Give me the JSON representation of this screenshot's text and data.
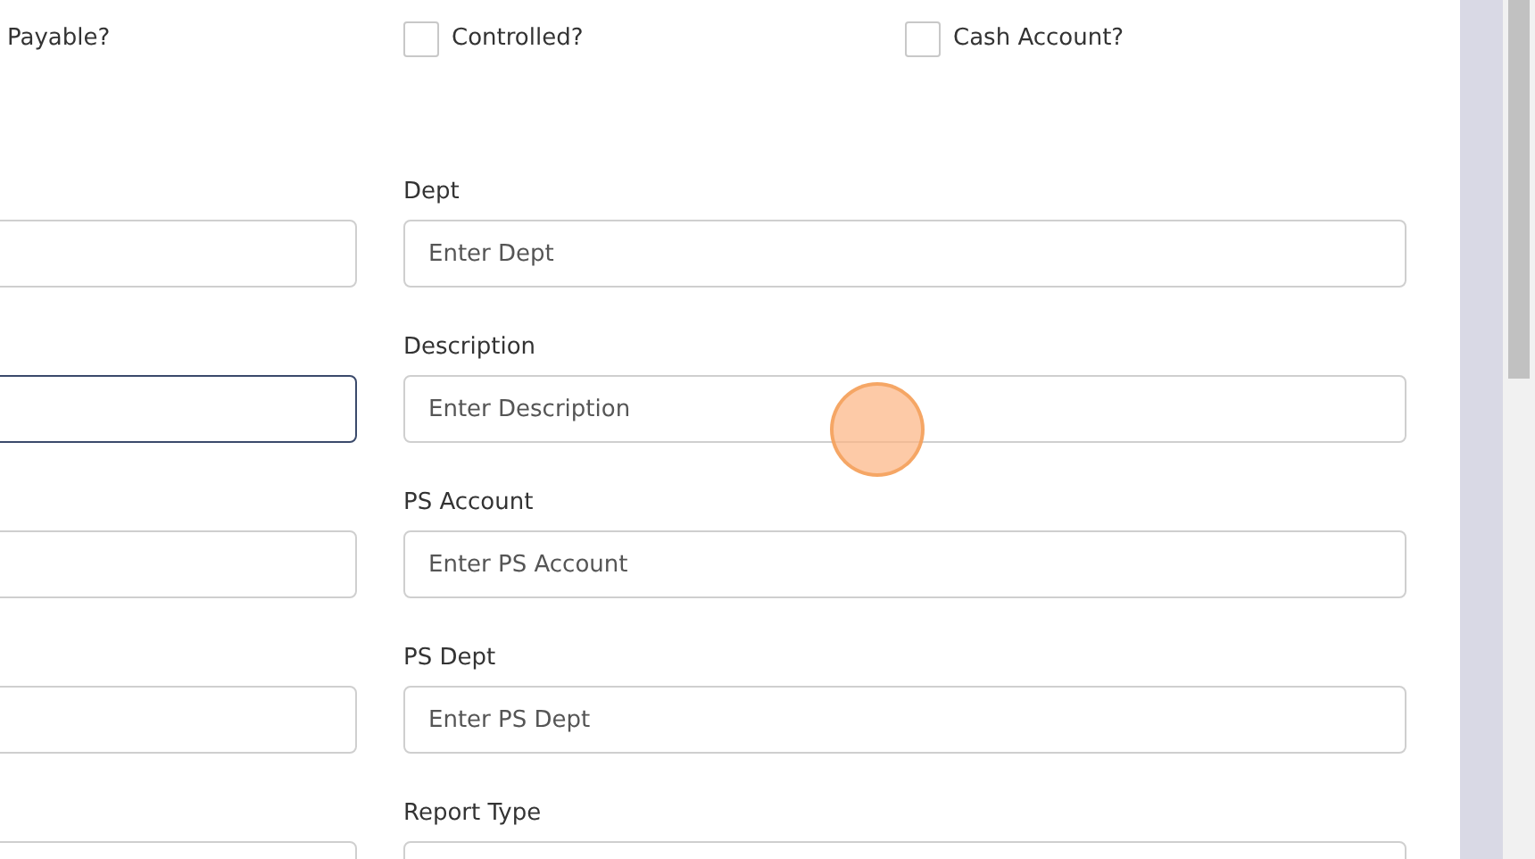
{
  "checkboxes": [
    {
      "label": "Payable?"
    },
    {
      "label": "Controlled?",
      "checked": false
    },
    {
      "label": "Cash Account?",
      "checked": false
    }
  ],
  "rows": [
    {
      "left": {
        "focused": false
      },
      "right": {
        "label": "Dept",
        "placeholder": "Enter Dept",
        "focused": false
      }
    },
    {
      "left": {
        "focused": true
      },
      "right": {
        "label": "Description",
        "placeholder": "Enter Description",
        "focused": false
      }
    },
    {
      "left": {
        "focused": false
      },
      "right": {
        "label": "PS Account",
        "placeholder": "Enter PS Account",
        "focused": false
      }
    },
    {
      "left": {
        "focused": false
      },
      "right": {
        "label": "PS Dept",
        "placeholder": "Enter PS Dept",
        "focused": false
      }
    },
    {
      "left": {
        "focused": false
      },
      "right": {
        "label": "Report Type",
        "focused": false
      }
    }
  ]
}
